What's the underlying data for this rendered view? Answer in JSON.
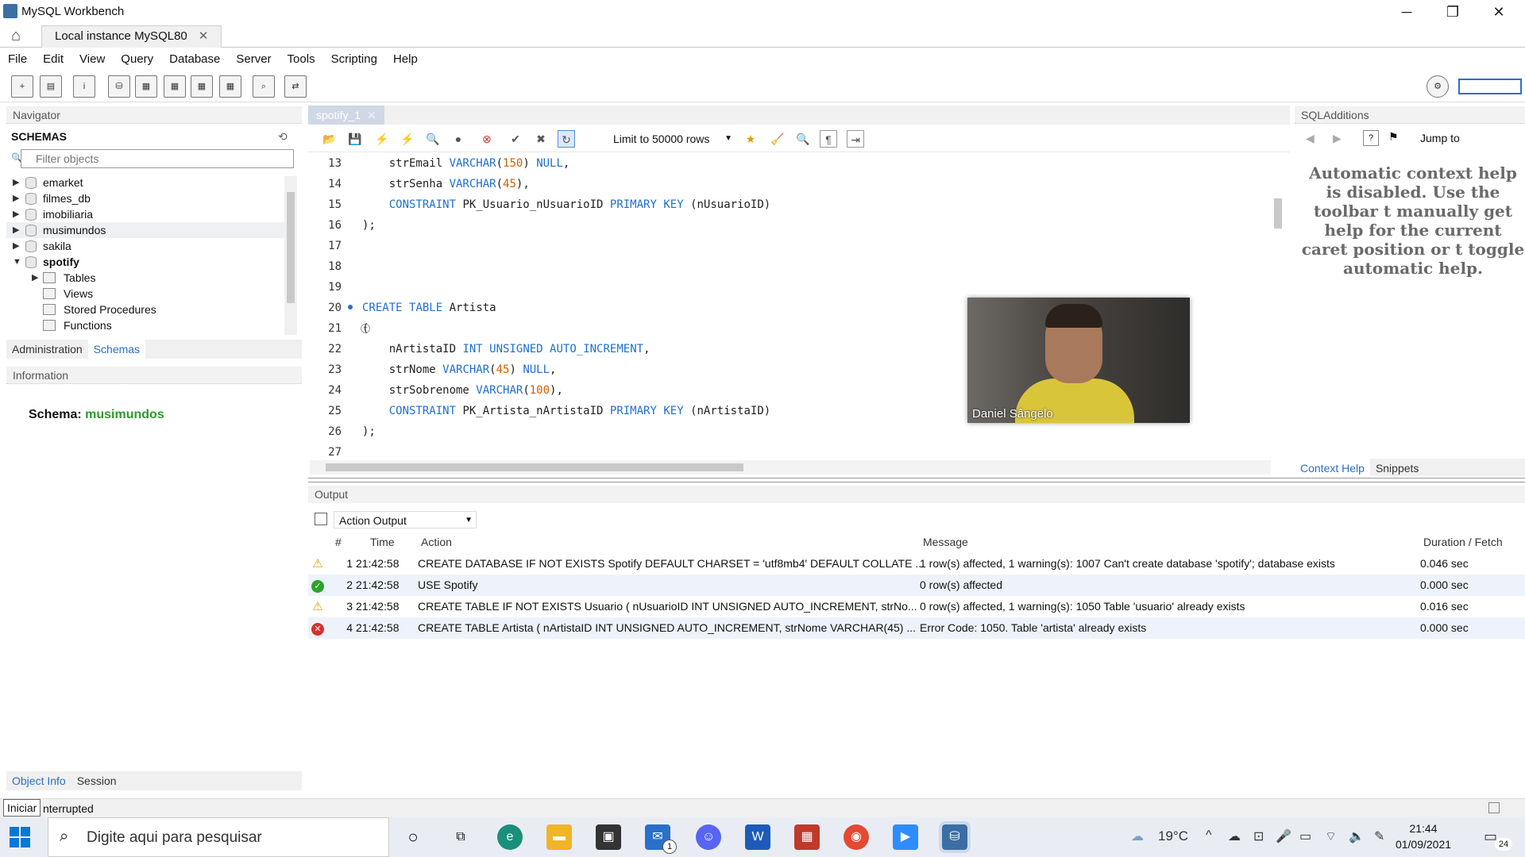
{
  "window": {
    "title": "MySQL Workbench",
    "min": "─",
    "max": "❐",
    "close": "✕"
  },
  "conn_tab": {
    "label": "Local instance MySQL80",
    "close": "✕"
  },
  "menu": [
    "File",
    "Edit",
    "View",
    "Query",
    "Database",
    "Server",
    "Tools",
    "Scripting",
    "Help"
  ],
  "navigator": {
    "header": "Navigator",
    "schemas_label": "SCHEMAS",
    "filter_placeholder": "Filter objects",
    "tree": [
      {
        "label": "emarket",
        "bold": false
      },
      {
        "label": "filmes_db",
        "bold": false
      },
      {
        "label": "imobiliaria",
        "bold": false
      },
      {
        "label": "musimundos",
        "bold": false
      },
      {
        "label": "sakila",
        "bold": false
      },
      {
        "label": "spotify",
        "bold": true
      },
      {
        "label": "Tables"
      },
      {
        "label": "Views"
      },
      {
        "label": "Stored Procedures"
      },
      {
        "label": "Functions"
      }
    ],
    "tabs": [
      "Administration",
      "Schemas"
    ]
  },
  "information": {
    "header": "Information",
    "schema_label": "Schema:",
    "schema_value": "musimundos",
    "tabs": [
      "Object Info",
      "Session"
    ]
  },
  "editor": {
    "tab_label": "spotify_1",
    "limit_label": "Limit to 50000 rows",
    "lines": [
      {
        "n": "13",
        "text": "    strEmail VARCHAR(150) NULL,"
      },
      {
        "n": "14",
        "text": "    strSenha VARCHAR(45),"
      },
      {
        "n": "15",
        "text": "    CONSTRAINT PK_Usuario_nUsuarioID PRIMARY KEY (nUsuarioID)"
      },
      {
        "n": "16",
        "text": ");"
      },
      {
        "n": "17",
        "text": ""
      },
      {
        "n": "18",
        "text": ""
      },
      {
        "n": "19",
        "text": ""
      },
      {
        "n": "20",
        "text": "CREATE TABLE Artista"
      },
      {
        "n": "21",
        "text": "("
      },
      {
        "n": "22",
        "text": "    nArtistaID INT UNSIGNED AUTO_INCREMENT,"
      },
      {
        "n": "23",
        "text": "    strNome VARCHAR(45) NULL,"
      },
      {
        "n": "24",
        "text": "    strSobrenome VARCHAR(100),"
      },
      {
        "n": "25",
        "text": "    CONSTRAINT PK_Artista_nArtistaID PRIMARY KEY (nArtistaID)"
      },
      {
        "n": "26",
        "text": ");"
      },
      {
        "n": "27",
        "text": ""
      }
    ]
  },
  "video": {
    "name": "Daniel Sângelo"
  },
  "sql_additions": {
    "header": "SQLAdditions",
    "jump_to": "Jump to",
    "help_text": "Automatic context help is disabled. Use the toolbar t manually get help for the current caret position or t toggle automatic help.",
    "tabs": [
      "Context Help",
      "Snippets"
    ]
  },
  "output": {
    "header": "Output",
    "selector": "Action Output",
    "columns": [
      "#",
      "Time",
      "Action",
      "Message",
      "Duration / Fetch"
    ],
    "rows": [
      {
        "status": "warning",
        "n": "1",
        "time": "21:42:58",
        "action": "CREATE DATABASE IF NOT EXISTS Spotify DEFAULT CHARSET = 'utf8mb4' DEFAULT COLLATE ...",
        "message": "1 row(s) affected, 1 warning(s): 1007 Can't create database 'spotify'; database exists",
        "duration": "0.046 sec"
      },
      {
        "status": "ok",
        "n": "2",
        "time": "21:42:58",
        "action": "USE Spotify",
        "message": "0 row(s) affected",
        "duration": "0.000 sec"
      },
      {
        "status": "warning",
        "n": "3",
        "time": "21:42:58",
        "action": "CREATE TABLE IF NOT EXISTS Usuario ( nUsuarioID INT UNSIGNED AUTO_INCREMENT,     strNo...",
        "message": "0 row(s) affected, 1 warning(s): 1050 Table 'usuario' already exists",
        "duration": "0.016 sec"
      },
      {
        "status": "error",
        "n": "4",
        "time": "21:42:58",
        "action": "CREATE TABLE Artista ( nArtistaID INT UNSIGNED AUTO_INCREMENT,     strNome VARCHAR(45) ...",
        "message": "Error Code: 1050. Table 'artista' already exists",
        "duration": "0.000 sec"
      }
    ]
  },
  "statusbar": {
    "tooltip": "Iniciar",
    "text": "nterrupted"
  },
  "taskbar": {
    "search_placeholder": "Digite aqui para pesquisar",
    "weather": "19°C",
    "time": "21:44",
    "date": "01/09/2021",
    "notif_count": "24",
    "mail_badge": "1"
  }
}
